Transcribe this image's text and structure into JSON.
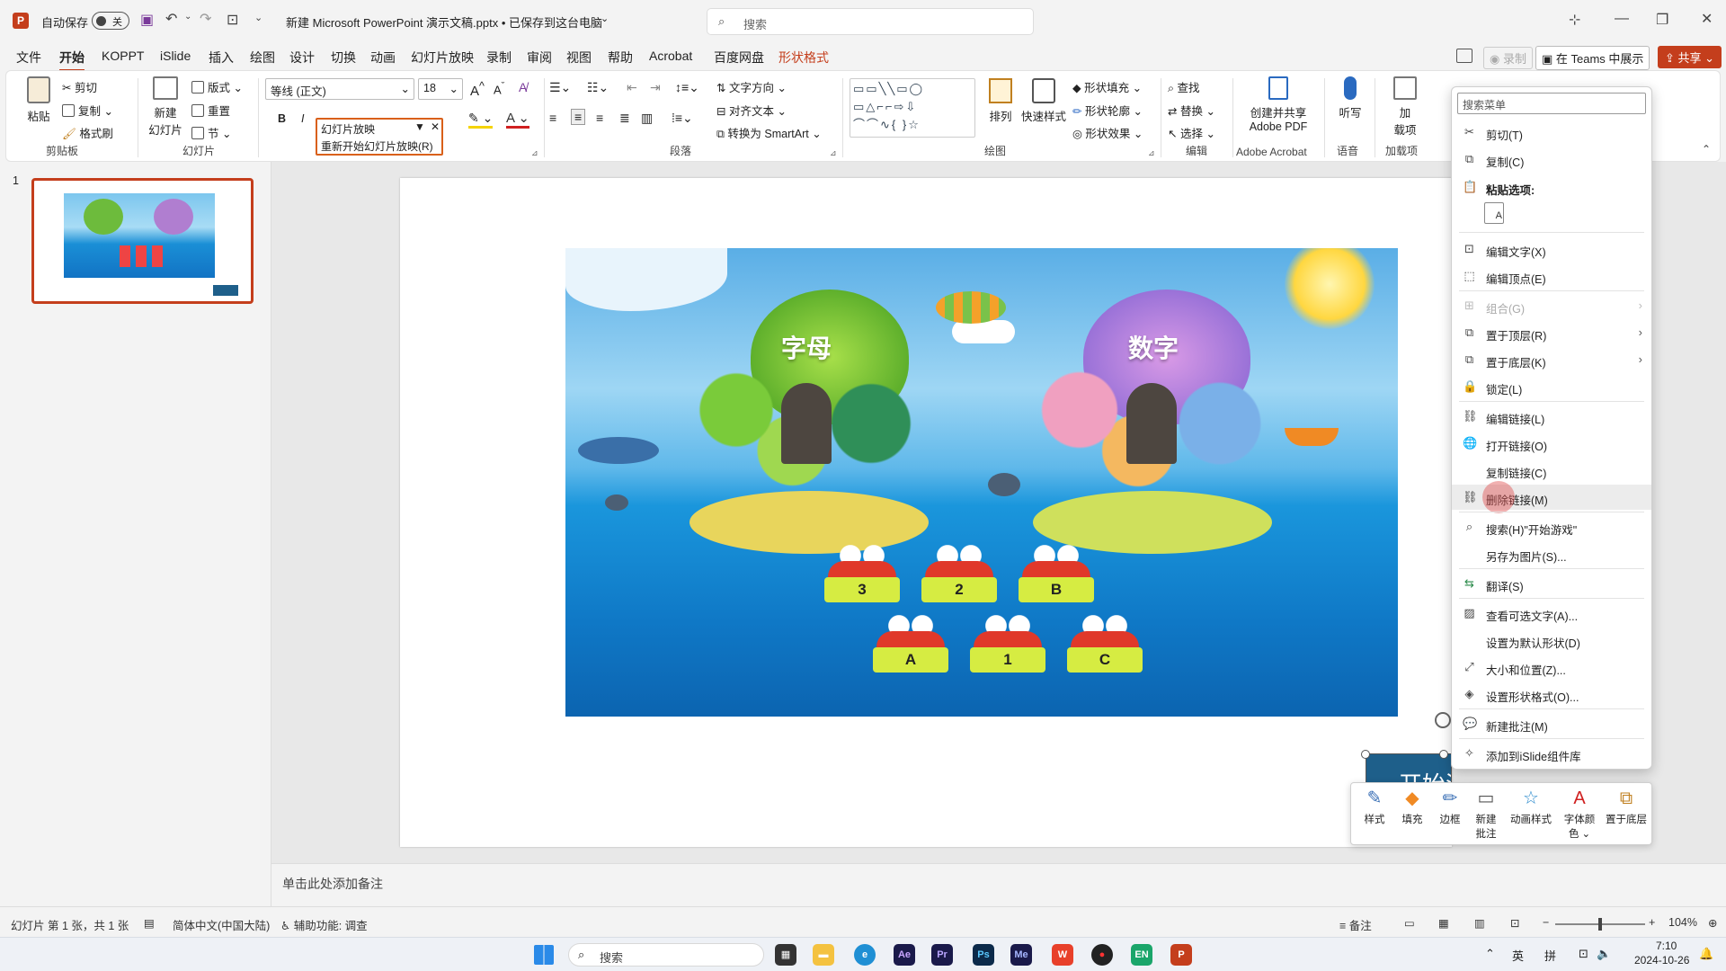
{
  "titlebar": {
    "autosave_label": "自动保存",
    "autosave_state": "关",
    "doc_title": "新建 Microsoft PowerPoint 演示文稿.pptx • 已保存到这台电脑",
    "search_placeholder": "搜索"
  },
  "tabs": [
    "文件",
    "开始",
    "KOPPT",
    "iSlide",
    "插入",
    "绘图",
    "设计",
    "切换",
    "动画",
    "幻灯片放映",
    "录制",
    "审阅",
    "视图",
    "帮助",
    "Acrobat",
    "百度网盘",
    "形状格式"
  ],
  "tab_right": {
    "record": "录制",
    "teams": "在 Teams 中展示",
    "share": "共享"
  },
  "ribbon": {
    "clipboard": {
      "paste": "粘贴",
      "cut": "剪切",
      "copy": "复制",
      "format_painter": "格式刷",
      "group": "剪贴板"
    },
    "slides": {
      "new_slide": "新建\n幻灯片",
      "new_slide_l1": "新建",
      "new_slide_l2": "幻灯片",
      "layout": "版式",
      "reset": "重置",
      "section": "节",
      "group": "幻灯片"
    },
    "font": {
      "family": "等线 (正文)",
      "size": "18",
      "bold": "B",
      "italic": "I"
    },
    "slideshow_dropdown": {
      "item1": "幻灯片放映",
      "item2": "重新开始幻灯片放映(R)"
    },
    "paragraph": {
      "text_direction": "文字方向",
      "align_text": "对齐文本",
      "smartart": "转换为 SmartArt",
      "group": "段落"
    },
    "drawing": {
      "arrange": "排列",
      "quick_styles": "快速样式",
      "fill": "形状填充",
      "outline": "形状轮廓",
      "effects": "形状效果",
      "group": "绘图"
    },
    "editing": {
      "find": "查找",
      "replace": "替换",
      "select": "选择",
      "group": "编辑"
    },
    "acrobat": {
      "create_l1": "创建并共享",
      "create_l2": "Adobe PDF",
      "group": "Adobe Acrobat"
    },
    "voice": {
      "dictate": "听写",
      "group": "语音"
    },
    "addins": {
      "label_l1": "加",
      "label_l2": "载项",
      "group": "加载项"
    }
  },
  "thumbnail": {
    "number": "1"
  },
  "slide": {
    "island_left": "字母",
    "island_right": "数字",
    "crabs_row1": [
      "3",
      "2",
      "B"
    ],
    "crabs_row2": [
      "A",
      "1",
      "C"
    ],
    "button_text": "开始游戏"
  },
  "notes_placeholder": "单击此处添加备注",
  "context_menu": {
    "search_placeholder": "搜索菜单",
    "items": [
      {
        "label": "剪切(T)",
        "icon": "scissors-icon"
      },
      {
        "label": "复制(C)",
        "icon": "copy-icon"
      },
      {
        "label": "粘贴选项:",
        "icon": "paste-icon"
      },
      {
        "label": "编辑文字(X)",
        "icon": "edit-text-icon"
      },
      {
        "label": "编辑顶点(E)",
        "icon": "edit-points-icon"
      },
      {
        "label": "组合(G)",
        "icon": "group-icon"
      },
      {
        "label": "置于顶层(R)",
        "icon": "bring-front-icon"
      },
      {
        "label": "置于底层(K)",
        "icon": "send-back-icon"
      },
      {
        "label": "锁定(L)",
        "icon": "lock-icon"
      },
      {
        "label": "编辑链接(L)",
        "icon": "link-icon"
      },
      {
        "label": "打开链接(O)",
        "icon": "open-link-icon"
      },
      {
        "label": "复制链接(C)",
        "icon": "copy-link-icon"
      },
      {
        "label": "删除链接(M)",
        "icon": "remove-link-icon"
      },
      {
        "label": "搜索(H)\"开始游戏\"",
        "icon": "search-icon"
      },
      {
        "label": "另存为图片(S)...",
        "icon": "none"
      },
      {
        "label": "翻译(S)",
        "icon": "translate-icon"
      },
      {
        "label": "查看可选文字(A)...",
        "icon": "alt-text-icon"
      },
      {
        "label": "设置为默认形状(D)",
        "icon": "none"
      },
      {
        "label": "大小和位置(Z)...",
        "icon": "size-icon"
      },
      {
        "label": "设置形状格式(O)...",
        "icon": "format-shape-icon"
      },
      {
        "label": "新建批注(M)",
        "icon": "comment-icon"
      },
      {
        "label": "添加到iSlide组件库",
        "icon": "islide-icon"
      }
    ]
  },
  "mini_toolbar": {
    "style": "样式",
    "fill": "填充",
    "border": "边框",
    "new_comment_l1": "新建",
    "new_comment_l2": "批注",
    "anim": "动画样式",
    "font_color_l1": "字体颜",
    "font_color_l2": "色",
    "send_back": "置于底层"
  },
  "status": {
    "slide_info": "幻灯片 第 1 张，共 1 张",
    "language": "简体中文(中国大陆)",
    "accessibility": "辅助功能: 调查",
    "notes": "备注",
    "zoom": "104%"
  },
  "taskbar": {
    "search": "搜索",
    "ime1": "英",
    "ime2": "拼",
    "time": "7:10",
    "date": "2024-10-26"
  }
}
